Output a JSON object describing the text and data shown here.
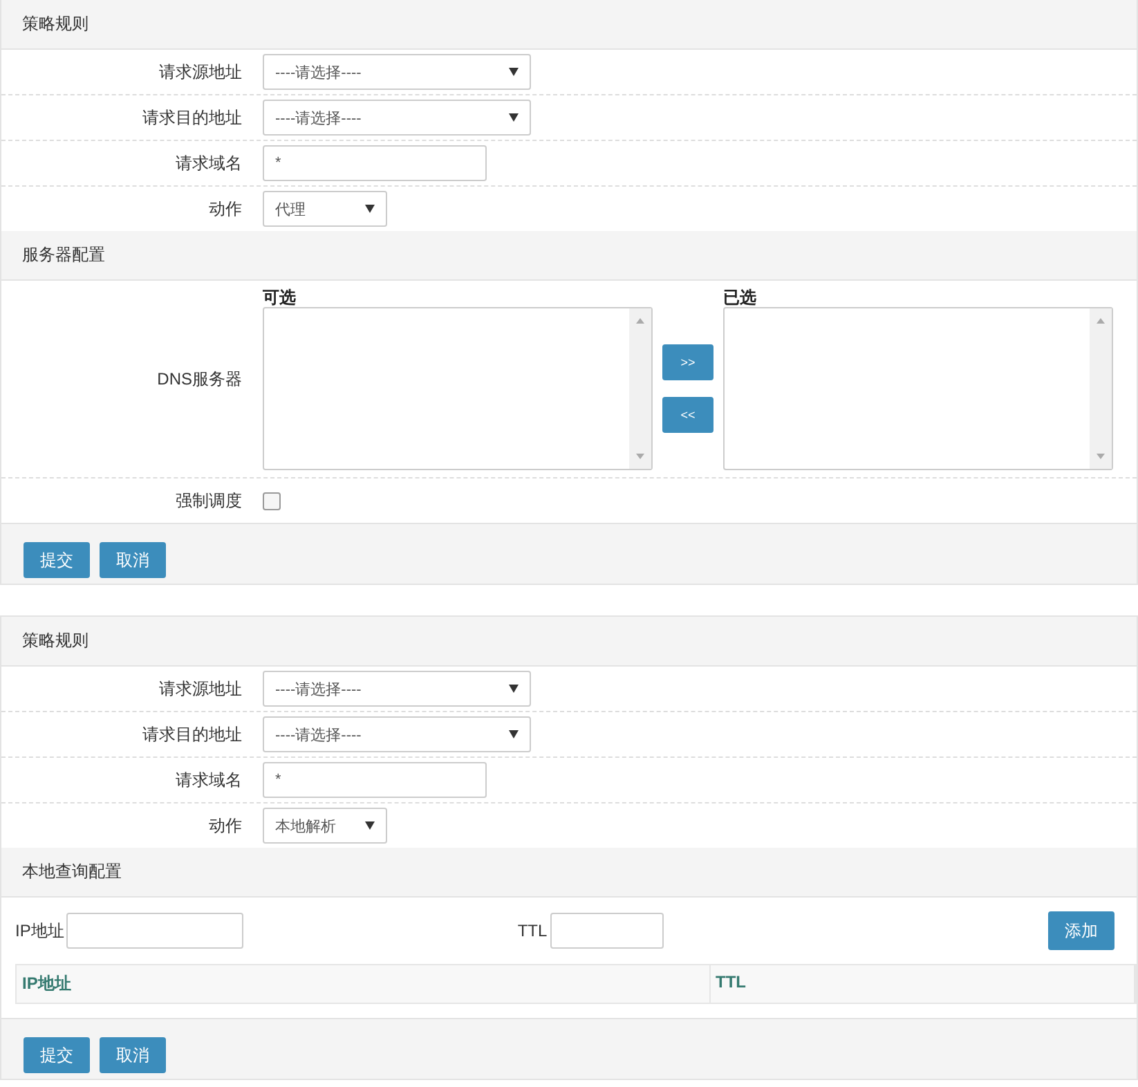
{
  "panels": [
    {
      "rules": {
        "title": "策略规则",
        "fields": [
          {
            "label": "请求源地址",
            "kind": "select",
            "value": "----请选择----"
          },
          {
            "label": "请求目的地址",
            "kind": "select",
            "value": "----请选择----"
          },
          {
            "label": "请求域名",
            "kind": "text",
            "value": "*"
          },
          {
            "label": "动作",
            "kind": "short_select",
            "value": "代理"
          }
        ]
      },
      "config": {
        "kind": "dual",
        "title": "服务器配置",
        "label": "DNS服务器",
        "available_title": "可选",
        "selected_title": "已选",
        "move_right": ">>",
        "move_left": "<<",
        "checkbox_label": "强制调度",
        "checked": false
      },
      "buttons": [
        "提交",
        "取消"
      ]
    },
    {
      "rules": {
        "title": "策略规则",
        "fields": [
          {
            "label": "请求源地址",
            "kind": "select",
            "value": "----请选择----"
          },
          {
            "label": "请求目的地址",
            "kind": "select",
            "value": "----请选择----"
          },
          {
            "label": "请求域名",
            "kind": "text",
            "value": "*"
          },
          {
            "label": "动作",
            "kind": "short_select",
            "value": "本地解析"
          }
        ]
      },
      "config": {
        "kind": "local",
        "title": "本地查询配置",
        "ip_label": "IP地址",
        "ttl_label": "TTL",
        "add_button": "添加",
        "columns": [
          "IP地址",
          "TTL"
        ]
      },
      "buttons": [
        "提交",
        "取消"
      ]
    }
  ]
}
